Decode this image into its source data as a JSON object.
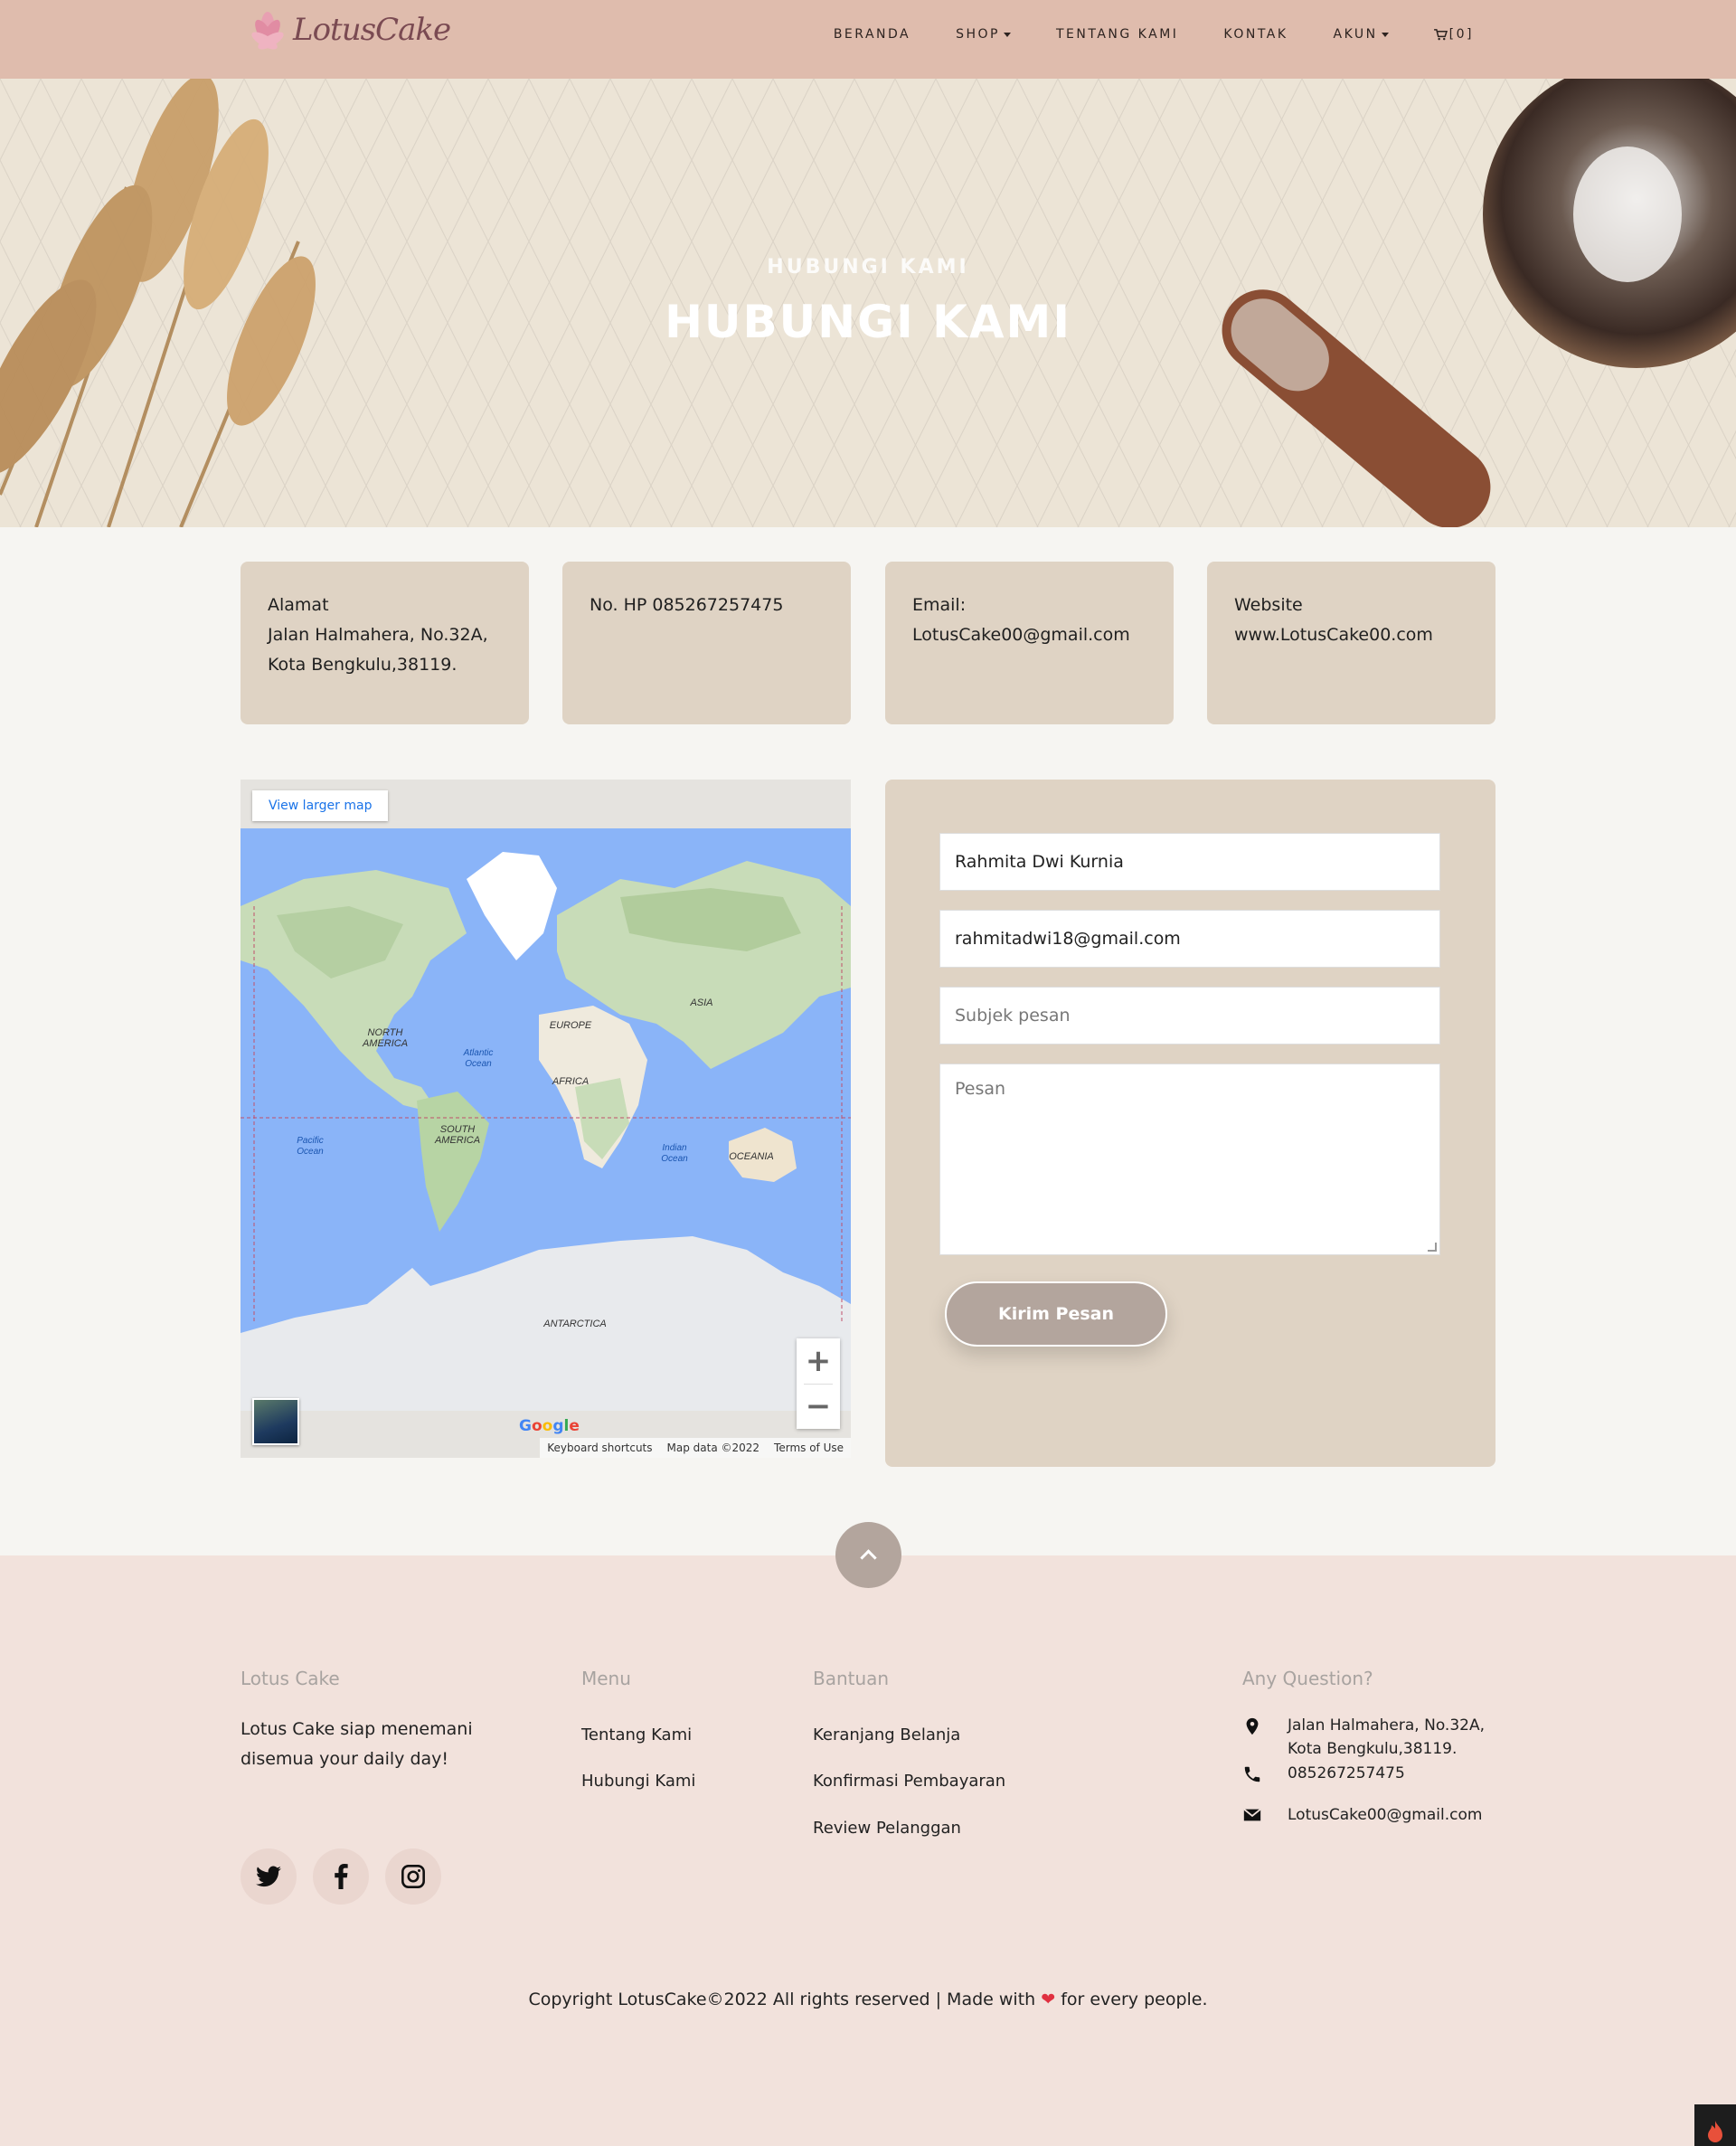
{
  "brand": {
    "logo_text": "LotusCake"
  },
  "nav": {
    "items": [
      {
        "label": "BERANDA",
        "has_caret": false
      },
      {
        "label": "SHOP",
        "has_caret": true
      },
      {
        "label": "TENTANG KAMI",
        "has_caret": false
      },
      {
        "label": "KONTAK",
        "has_caret": false
      },
      {
        "label": "AKUN",
        "has_caret": true
      }
    ],
    "cart_label": "[0]"
  },
  "hero": {
    "subtitle": "HUBUNGI KAMI",
    "title": "HUBUNGI KAMI"
  },
  "info_cards": [
    {
      "lines": [
        "Alamat",
        "Jalan Halmahera, No.32A,",
        "Kota Bengkulu,38119."
      ]
    },
    {
      "lines": [
        "No. HP 085267257475"
      ]
    },
    {
      "lines": [
        "Email:",
        "LotusCake00@gmail.com"
      ]
    },
    {
      "lines": [
        "Website",
        "www.LotusCake00.com"
      ]
    }
  ],
  "map": {
    "view_larger": "View larger map",
    "labels": [
      "NORTH AMERICA",
      "EUROPE",
      "ASIA",
      "AFRICA",
      "SOUTH AMERICA",
      "OCEANIA",
      "ANTARCTICA",
      "Atlantic Ocean",
      "Pacific Ocean",
      "Indian Ocean"
    ],
    "google": "Google",
    "footer": [
      "Keyboard shortcuts",
      "Map data ©2022",
      "Terms of Use"
    ]
  },
  "form": {
    "name_value": "Rahmita Dwi Kurnia",
    "email_value": "rahmitadwi18@gmail.com",
    "subject_placeholder": "Subjek pesan",
    "message_placeholder": "Pesan",
    "submit_label": "Kirim Pesan"
  },
  "footer": {
    "col1": {
      "heading": "Lotus Cake",
      "text_lines": [
        "Lotus Cake siap menemani",
        "disemua your daily day!"
      ]
    },
    "col2": {
      "heading": "Menu",
      "links": [
        "Tentang Kami",
        "Hubungi Kami"
      ]
    },
    "col3": {
      "heading": "Bantuan",
      "links": [
        "Keranjang Belanja",
        "Konfirmasi Pembayaran",
        "Review Pelanggan"
      ]
    },
    "col4": {
      "heading": "Any Question?",
      "address_lines": [
        "Jalan Halmahera, No.32A,",
        "Kota Bengkulu,38119."
      ],
      "phone": "085267257475",
      "email": "LotusCake00@gmail.com"
    },
    "copyright_before": "Copyright LotusCake©2022 All rights reserved | Made with",
    "copyright_after": "for every people."
  },
  "colors": {
    "nav_bg": "#dfbcad",
    "card_bg": "#dfd3c4",
    "button_bg": "#b3a59d",
    "footer_bg": "#f2e2dc",
    "ocean": "#8ab4f8",
    "heart": "#e03040"
  },
  "icons": {
    "social": [
      "twitter-icon",
      "facebook-icon",
      "instagram-icon"
    ],
    "contact": [
      "map-pin-icon",
      "phone-icon",
      "envelope-icon"
    ]
  }
}
